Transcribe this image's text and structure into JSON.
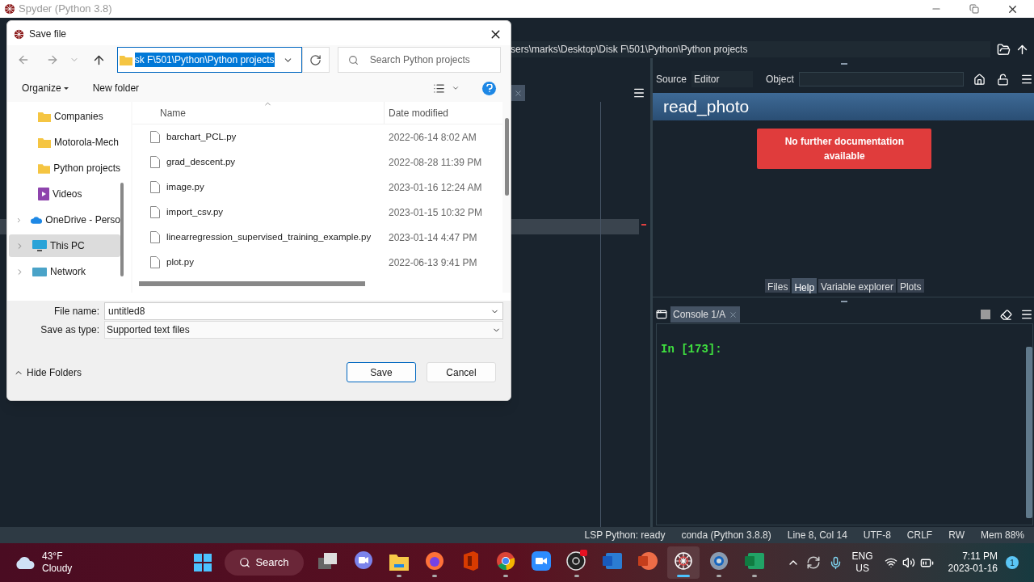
{
  "app_title": "Spyder (Python 3.8)",
  "path_bar": {
    "text": "sers\\marks\\Desktop\\Disk F\\501\\Python\\Python projects"
  },
  "help_pane": {
    "source_label": "Source",
    "source_value": "Editor",
    "object_label": "Object",
    "title": "read_photo",
    "message": "No further documentation available",
    "tabs": [
      {
        "label": "Files",
        "selected": false
      },
      {
        "label": "Help",
        "selected": true
      },
      {
        "label": "Variable explorer",
        "selected": false
      },
      {
        "label": "Plots",
        "selected": false
      }
    ]
  },
  "console": {
    "tab": "Console 1/A",
    "prompt": "In [173]:"
  },
  "status_bar": [
    "LSP Python: ready",
    "conda (Python 3.8.8)",
    "Line 8, Col 14",
    "UTF-8",
    "CRLF",
    "RW",
    "Mem 88%"
  ],
  "dialog": {
    "title": "Save file",
    "address": {
      "text": "sk F\\501\\Python\\Python projects",
      "highlighted": true
    },
    "search": {
      "placeholder": "Search Python projects"
    },
    "toolbar": {
      "organize": "Organize",
      "new_folder": "New folder"
    },
    "nav": [
      {
        "label": "Companies",
        "kind": "folder",
        "expandable": false,
        "selected": false
      },
      {
        "label": "Motorola-Mech",
        "kind": "folder",
        "expandable": false,
        "selected": false
      },
      {
        "label": "Python projects",
        "kind": "folder",
        "expandable": false,
        "selected": false
      },
      {
        "label": "Videos",
        "kind": "video",
        "expandable": false,
        "selected": false
      },
      {
        "label": "OneDrive - Perso",
        "kind": "cloud",
        "expandable": true,
        "selected": false
      },
      {
        "label": "This PC",
        "kind": "pc",
        "expandable": true,
        "selected": true
      },
      {
        "label": "Network",
        "kind": "network",
        "expandable": true,
        "selected": false
      }
    ],
    "columns": [
      "Name",
      "Date modified"
    ],
    "files": [
      {
        "name": "barchart_PCL.py",
        "date": "2022-06-14 8:02 AM"
      },
      {
        "name": "grad_descent.py",
        "date": "2022-08-28 11:39 PM"
      },
      {
        "name": "image.py",
        "date": "2023-01-16 12:24 AM"
      },
      {
        "name": "import_csv.py",
        "date": "2023-01-15 10:32 PM"
      },
      {
        "name": "linearregression_supervised_training_example.py",
        "date": "2023-01-14 4:47 PM"
      },
      {
        "name": "plot.py",
        "date": "2022-06-13 9:41 PM"
      }
    ],
    "file_name_label": "File name:",
    "file_name": "untitled8",
    "type_label": "Save as type:",
    "type_value": "Supported text files",
    "hide_folders": "Hide Folders",
    "save": "Save",
    "cancel": "Cancel"
  },
  "taskbar": {
    "temperature": "43°F",
    "weather": "Cloudy",
    "search": "Search",
    "apps": [
      {
        "kind": "task-view",
        "running": false,
        "selected": false
      },
      {
        "kind": "chat",
        "running": false,
        "selected": false
      },
      {
        "kind": "explorer",
        "running": true,
        "selected": false
      },
      {
        "kind": "firefox",
        "running": true,
        "selected": false
      },
      {
        "kind": "office",
        "running": false,
        "selected": false
      },
      {
        "kind": "chrome",
        "running": true,
        "selected": false
      },
      {
        "kind": "zoom",
        "running": false,
        "selected": false
      },
      {
        "kind": "obs",
        "running": true,
        "selected": false
      },
      {
        "kind": "word",
        "running": false,
        "selected": false
      },
      {
        "kind": "powerpoint",
        "running": false,
        "selected": false
      },
      {
        "kind": "spyder",
        "running": true,
        "selected": true
      },
      {
        "kind": "settings",
        "running": true,
        "selected": false
      },
      {
        "kind": "excel",
        "running": true,
        "selected": false
      }
    ],
    "language": "ENG",
    "region": "US",
    "time": "7:11 PM",
    "date": "2023-01-16",
    "notifications": "1"
  }
}
